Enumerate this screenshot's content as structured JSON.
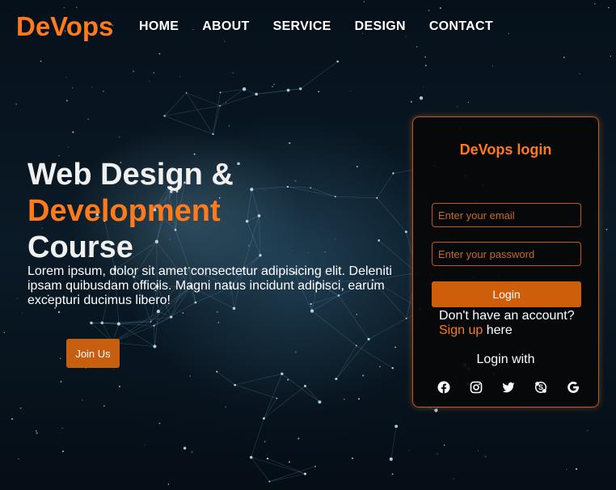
{
  "brand": {
    "logo": "DeVops"
  },
  "nav": {
    "items": [
      {
        "label": "HOME"
      },
      {
        "label": "ABOUT"
      },
      {
        "label": "SERVICE"
      },
      {
        "label": "DESIGN"
      },
      {
        "label": "CONTACT"
      }
    ]
  },
  "hero": {
    "title_line1": "Web Design &",
    "title_accent": "Development",
    "title_line3": "Course",
    "description": "Lorem ipsum, dolor sit amet consectetur adipisicing elit. Deleniti ipsam quibusdam officiis. Magni natus incidunt adipisci, earum excepturi ducimus libero!",
    "join_label": "Join Us"
  },
  "login": {
    "title": "DeVops login",
    "email_placeholder": "Enter your email",
    "password_placeholder": "Enter your password",
    "button_label": "Login",
    "account_prompt": "Don't have an account?",
    "signup_label": "Sign up",
    "signup_suffix": " here",
    "login_with": "Login with",
    "socials": [
      "facebook-icon",
      "instagram-icon",
      "twitter-icon",
      "skype-icon",
      "google-icon"
    ]
  },
  "colors": {
    "accent": "#ff7a1a",
    "button": "#cf5e0b",
    "background": "#050b12"
  }
}
